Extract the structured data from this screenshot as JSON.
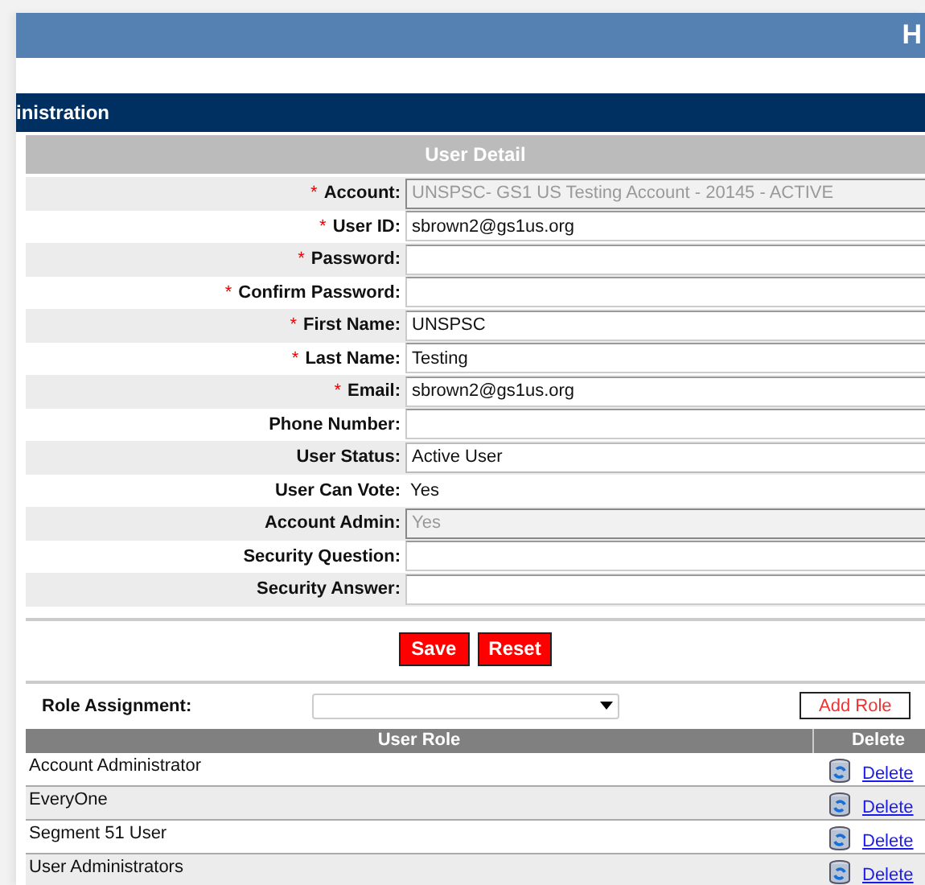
{
  "header": {
    "title": "H"
  },
  "section": {
    "title": "inistration"
  },
  "panel": {
    "title": "User Detail"
  },
  "fields": [
    {
      "label": "Account:",
      "required_mark": "*",
      "kind": "input",
      "value": "UNSPSC- GS1 US Testing Account - 20145 - ACTIVE",
      "disabled": true
    },
    {
      "label": "User ID:",
      "required_mark": "*",
      "kind": "input",
      "value": "sbrown2@gs1us.org",
      "disabled": false
    },
    {
      "label": "Password:",
      "required_mark": "*",
      "kind": "input",
      "disabled": false
    },
    {
      "label": "Confirm Password:",
      "required_mark": "*",
      "kind": "input",
      "disabled": false
    },
    {
      "label": "First Name:",
      "required_mark": "*",
      "kind": "input",
      "value": "UNSPSC",
      "disabled": false
    },
    {
      "label": "Last Name:",
      "required_mark": "*",
      "kind": "input",
      "value": "Testing",
      "disabled": false
    },
    {
      "label": "Email:",
      "required_mark": "*",
      "kind": "input",
      "value": "sbrown2@gs1us.org",
      "disabled": false
    },
    {
      "label": "Phone Number:",
      "kind": "input",
      "disabled": false
    },
    {
      "label": "User Status:",
      "kind": "select",
      "value": "Active User",
      "disabled": false
    },
    {
      "label": "User Can Vote:",
      "kind": "text",
      "value": "Yes",
      "disabled": false
    },
    {
      "label": "Account Admin:",
      "kind": "select",
      "value": "Yes",
      "disabled": true
    },
    {
      "label": "Security Question:",
      "kind": "input",
      "disabled": false
    },
    {
      "label": "Security Answer:",
      "kind": "input",
      "disabled": false
    }
  ],
  "buttons": [
    "Save",
    "Reset"
  ],
  "role_assignment": {
    "label": "Role Assignment:",
    "button": "Add Role"
  },
  "roles": {
    "columns": [
      "User Role",
      "Delete"
    ],
    "rows": [
      {
        "name": "Account Administrator",
        "action": "Delete"
      },
      {
        "name": "EveryOne",
        "action": "Delete"
      },
      {
        "name": "Segment 51 User",
        "action": "Delete"
      },
      {
        "name": "User Administrators",
        "action": "Delete"
      }
    ]
  }
}
